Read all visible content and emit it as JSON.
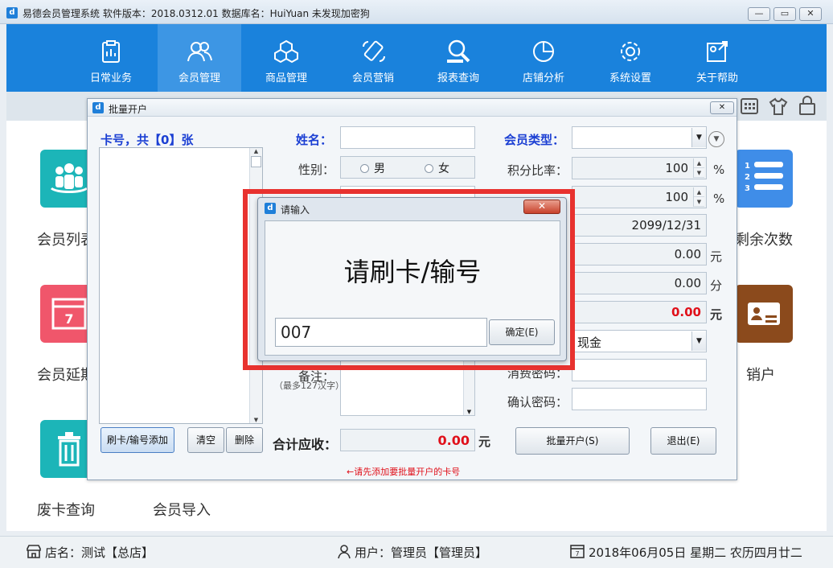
{
  "window": {
    "title": "易德会员管理系统   软件版本：2018.0312.01    数据库名：HuiYuan    未发现加密狗"
  },
  "nav": [
    {
      "label": "日常业务",
      "icon": "clipboard-icon"
    },
    {
      "label": "会员管理",
      "icon": "members-icon",
      "active": true
    },
    {
      "label": "商品管理",
      "icon": "boxes-icon"
    },
    {
      "label": "会员营销",
      "icon": "phone-icon"
    },
    {
      "label": "报表查询",
      "icon": "search-report-icon"
    },
    {
      "label": "店铺分析",
      "icon": "pie-chart-icon"
    },
    {
      "label": "系统设置",
      "icon": "gear-icon"
    },
    {
      "label": "关于帮助",
      "icon": "help-icon"
    }
  ],
  "tiles": {
    "member_list": "会员列表",
    "member_extend": "会员延期",
    "discard_query": "废卡查询",
    "member_import": "会员导入",
    "remaining_times": "剩余次数",
    "cancel_account": "销户"
  },
  "status": {
    "store": "店名：测试【总店】",
    "user": "用户：管理员【管理员】",
    "date": "2018年06月05日 星期二 农历四月廿二"
  },
  "batch": {
    "title": "批量开户",
    "card_count": "卡号，共【0】张",
    "name_label": "姓名：",
    "gender_label": "性别：",
    "male": "男",
    "female": "女",
    "remark_label": "备注：",
    "remark_hint": "（最多127汉字）",
    "member_type_label": "会员类型：",
    "points_rate_label": "积分比率：",
    "points_rate": "100",
    "rate2": "100",
    "percent": "%",
    "expire": "2099/12/31",
    "val1": "0.00",
    "unit1": "元",
    "val2": "0.00",
    "unit2": "分",
    "val3": "0.00",
    "unit3": "元",
    "payment": "现金",
    "pwd_label": "消费密码：",
    "confirm_pwd_label": "确认密码：",
    "total_label": "合计应收：",
    "total": "0.00",
    "total_unit": "元",
    "btn_add": "刷卡/输号添加",
    "btn_clear": "清空",
    "btn_delete": "删除",
    "btn_open": "批量开户(S)",
    "btn_exit": "退出(E)",
    "hint": "←请先添加要批量开户的卡号"
  },
  "input_dialog": {
    "title": "请输入",
    "prompt": "请刷卡/输号",
    "value": "007",
    "ok": "确定(E)"
  }
}
